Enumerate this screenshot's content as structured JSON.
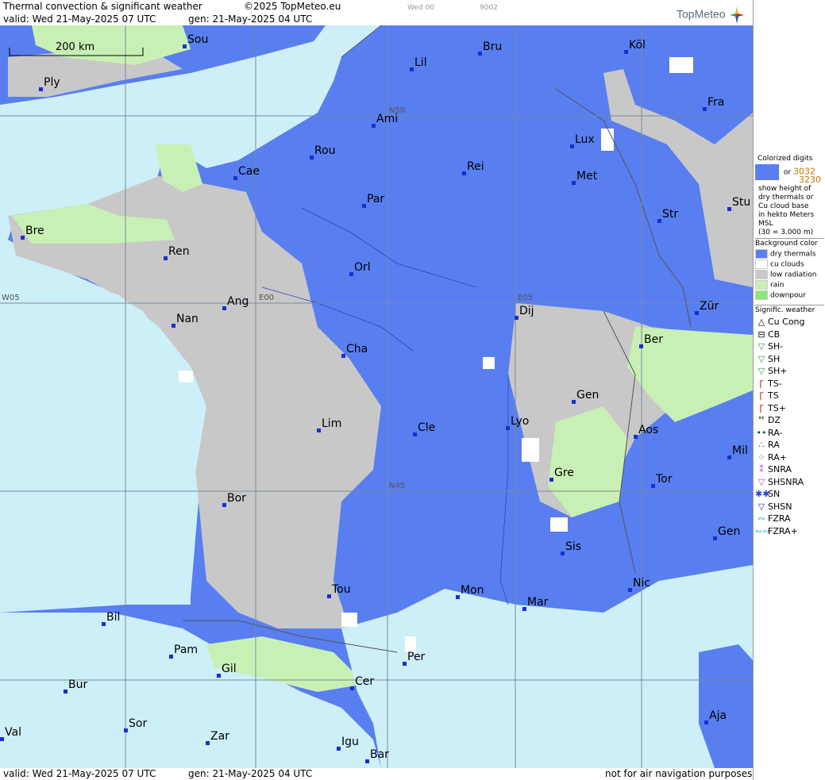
{
  "header": {
    "title": "Thermal convection & significant weather",
    "copyright": "©2025 TopMeteo.eu",
    "valid": "valid:  Wed  21-May-2025  07 UTC",
    "gen": "gen: 21-May-2025 04 UTC",
    "small1": "Wed 00",
    "small2": "9002",
    "brand": "TopMeteo"
  },
  "footer": {
    "valid": "valid:  Wed  21-May-2025  07 UTC",
    "gen": "gen: 21-May-2025 04 UTC",
    "disclaimer": "not for air navigation purposes"
  },
  "map": {
    "scale_label": "200 km",
    "grid_labels": [
      "N50",
      "N45",
      "W05",
      "E00",
      "E05"
    ],
    "cities": [
      "Sou",
      "Ply",
      "Lil",
      "Bru",
      "Köl",
      "Ami",
      "Fra",
      "Rou",
      "Lux",
      "Cae",
      "Rei",
      "Met",
      "Par",
      "Stu",
      "Bre",
      "Str",
      "Ren",
      "Orl",
      "Ang",
      "Dij",
      "Zür",
      "Nan",
      "Ber",
      "Cha",
      "Gen",
      "Lim",
      "Cle",
      "Lyo",
      "Aos",
      "Mil",
      "Gre",
      "Tor",
      "Bor",
      "Gen",
      "Sis",
      "Nic",
      "Tou",
      "Mon",
      "Mar",
      "Bil",
      "Pam",
      "Per",
      "Gil",
      "Cer",
      "Bur",
      "Sor",
      "Zar",
      "Val",
      "Igu",
      "Bar",
      "Aja"
    ]
  },
  "legend": {
    "colorized_title": "Colorized digits",
    "sample_a": "3032",
    "or": "or",
    "sample_b": "3230",
    "desc": [
      "show height of",
      "dry thermals or",
      "Cu cloud base",
      "in hekto Meters",
      "MSL",
      "(30 = 3.000 m)"
    ],
    "bg_title": "Background color",
    "bg_items": [
      {
        "label": "dry thermals",
        "color": "#587ef0"
      },
      {
        "label": "cu clouds",
        "color": "#ffffff"
      },
      {
        "label": "low radiation",
        "color": "#c8c8c8"
      },
      {
        "label": "rain",
        "color": "#c8f0b4"
      },
      {
        "label": "downpour",
        "color": "#8ce878"
      }
    ],
    "wx_title": "Signific. weather",
    "wx_items": [
      {
        "label": "Cu Cong",
        "icon": "cu-cong-icon",
        "glyph": "△",
        "color": "#000"
      },
      {
        "label": "CB",
        "icon": "cb-icon",
        "glyph": "⊟",
        "color": "#000"
      },
      {
        "label": "SH-",
        "icon": "shower-light-icon",
        "glyph": "▽",
        "color": "#2a9a2a"
      },
      {
        "label": "SH",
        "icon": "shower-icon",
        "glyph": "▽",
        "color": "#2a9a2a"
      },
      {
        "label": "SH+",
        "icon": "shower-heavy-icon",
        "glyph": "▽",
        "color": "#2a9a2a"
      },
      {
        "label": "TS-",
        "icon": "thunderstorm-light-icon",
        "glyph": "Ꞅ",
        "color": "#d01010"
      },
      {
        "label": "TS",
        "icon": "thunderstorm-icon",
        "glyph": "Ꞅ",
        "color": "#d01010"
      },
      {
        "label": "TS+",
        "icon": "thunderstorm-heavy-icon",
        "glyph": "Ꞅ",
        "color": "#d01010"
      },
      {
        "label": "DZ",
        "icon": "drizzle-icon",
        "glyph": "❜❜",
        "color": "#1a5a1a"
      },
      {
        "label": "RA-",
        "icon": "rain-light-icon",
        "glyph": "••",
        "color": "#1a5a1a"
      },
      {
        "label": "RA",
        "icon": "rain-icon",
        "glyph": "∴",
        "color": "#1a5a1a"
      },
      {
        "label": "RA+",
        "icon": "rain-heavy-icon",
        "glyph": "⁘",
        "color": "#1a5a1a"
      },
      {
        "label": "SNRA",
        "icon": "snow-rain-icon",
        "glyph": "⁑",
        "color": "#c040c0"
      },
      {
        "label": "SHSNRA",
        "icon": "snow-rain-shower-icon",
        "glyph": "▽",
        "color": "#c040c0"
      },
      {
        "label": "SN",
        "icon": "snow-icon",
        "glyph": "✱✱",
        "color": "#2040d0"
      },
      {
        "label": "SHSN",
        "icon": "snow-shower-icon",
        "glyph": "▽",
        "color": "#2040d0"
      },
      {
        "label": "FZRA",
        "icon": "freezing-rain-icon",
        "glyph": "∾",
        "color": "#20c0d0"
      },
      {
        "label": "FZRA+",
        "icon": "freezing-rain-heavy-icon",
        "glyph": "∾∾",
        "color": "#20c0d0"
      }
    ]
  }
}
